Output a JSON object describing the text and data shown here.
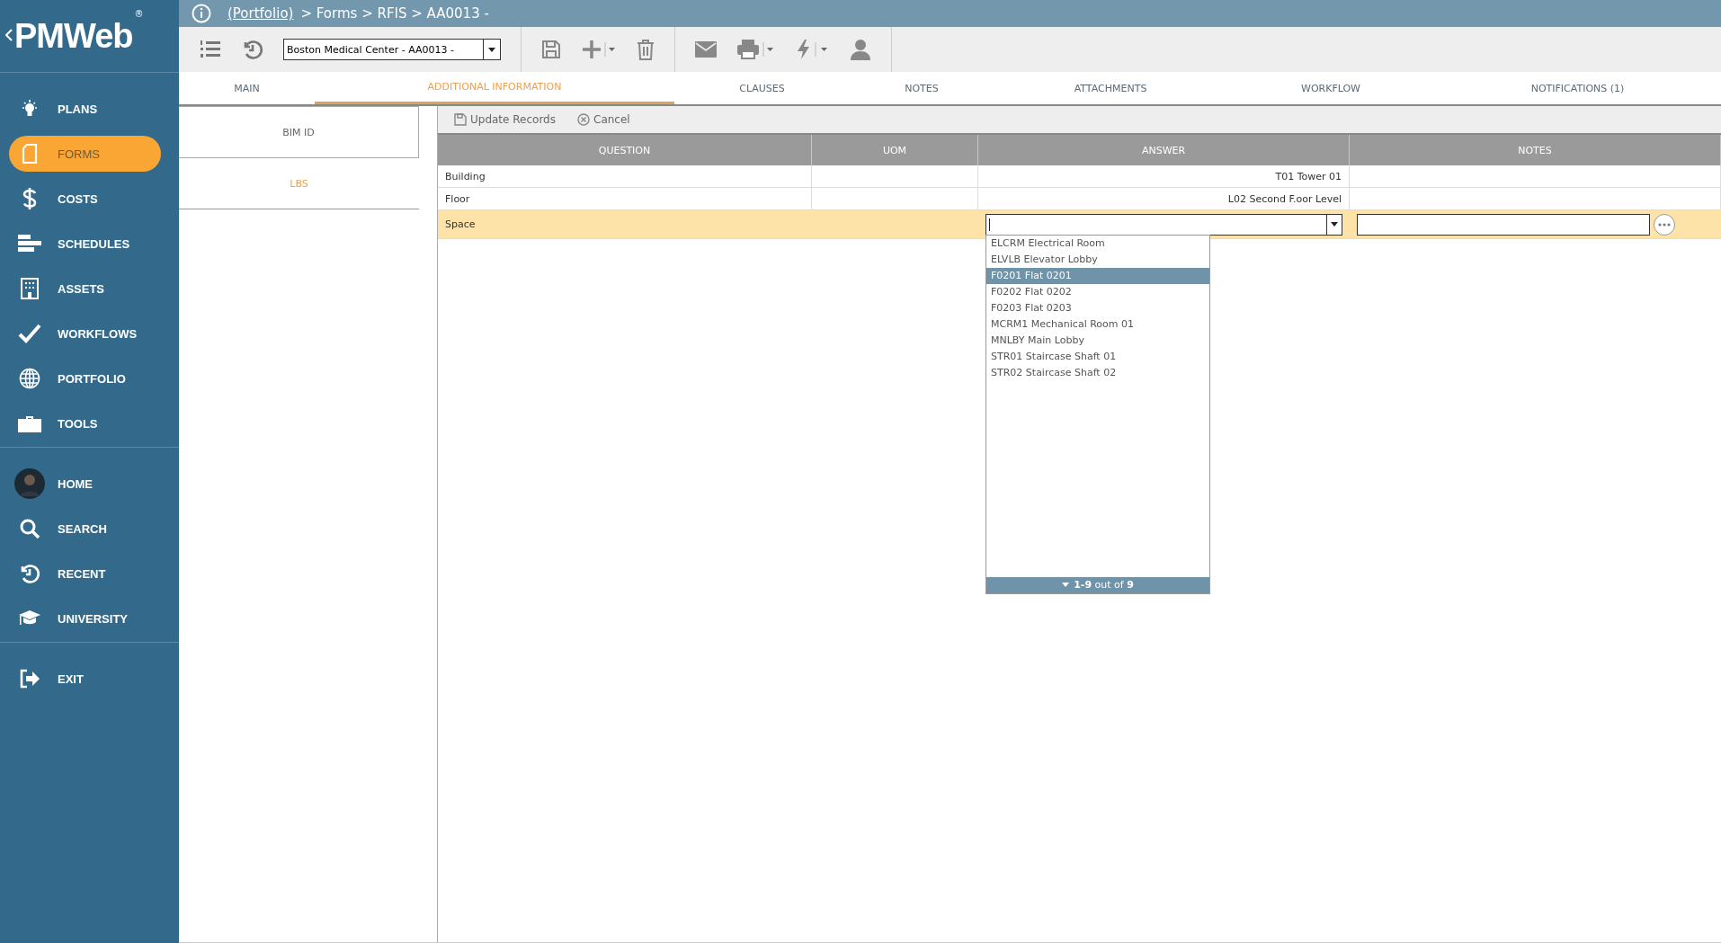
{
  "logo": {
    "text": "PMWeb",
    "mark": "®"
  },
  "sidebar": {
    "groups": [
      [
        {
          "label": "PLANS",
          "kind": "bulb",
          "selected": false
        },
        {
          "label": "FORMS",
          "kind": "doc",
          "selected": true
        },
        {
          "label": "COSTS",
          "kind": "dollar",
          "selected": false
        },
        {
          "label": "SCHEDULES",
          "kind": "bars",
          "selected": false
        },
        {
          "label": "ASSETS",
          "kind": "building",
          "selected": false
        },
        {
          "label": "WORKFLOWS",
          "kind": "check",
          "selected": false
        },
        {
          "label": "PORTFOLIO",
          "kind": "globe",
          "selected": false
        },
        {
          "label": "TOOLS",
          "kind": "case",
          "selected": false
        }
      ],
      [
        {
          "label": "HOME",
          "kind": "avatar",
          "selected": false
        },
        {
          "label": "SEARCH",
          "kind": "search",
          "selected": false
        },
        {
          "label": "RECENT",
          "kind": "history",
          "selected": false
        },
        {
          "label": "UNIVERSITY",
          "kind": "cap",
          "selected": false
        }
      ],
      [
        {
          "label": "EXIT",
          "kind": "exit",
          "selected": false
        }
      ]
    ]
  },
  "breadcrumb": {
    "link": "(Portfolio)",
    "text": "> Forms > RFIS > AA0013 -"
  },
  "toolbar": {
    "project_select": "Boston Medical Center - AA0013 -"
  },
  "tabs": [
    {
      "label": "MAIN",
      "selected": false
    },
    {
      "label": "ADDITIONAL INFORMATION",
      "selected": true
    },
    {
      "label": "CLAUSES",
      "selected": false
    },
    {
      "label": "NOTES",
      "selected": false
    },
    {
      "label": "ATTACHMENTS",
      "selected": false
    },
    {
      "label": "WORKFLOW",
      "selected": false
    },
    {
      "label": "NOTIFICATIONS (1)",
      "selected": false
    }
  ],
  "subnav": [
    {
      "label": "BIM ID",
      "selected": false
    },
    {
      "label": "LBS",
      "selected": true
    }
  ],
  "actions": [
    {
      "label": "Update Records",
      "kind": "save"
    },
    {
      "label": "Cancel",
      "kind": "cancel"
    }
  ],
  "table": {
    "columns": [
      "QUESTION",
      "UOM",
      "ANSWER",
      "NOTES"
    ],
    "rows": [
      {
        "kind": "text",
        "question": "Building",
        "uom": "",
        "answer": "T01 Tower 01",
        "notes": ""
      },
      {
        "kind": "text",
        "question": "Floor",
        "uom": "",
        "answer": "L02 Second F.oor Level",
        "notes": ""
      },
      {
        "kind": "editor",
        "question": "Space"
      }
    ]
  },
  "dropdown": {
    "options": [
      {
        "label": "ELCRM Electrical Room",
        "selected": false
      },
      {
        "label": "ELVLB Elevator Lobby",
        "selected": false
      },
      {
        "label": "F0201 Flat 0201",
        "selected": true
      },
      {
        "label": "F0202 Flat 0202",
        "selected": false
      },
      {
        "label": "F0203 Flat 0203",
        "selected": false
      },
      {
        "label": "MCRM1 Mechanical Room 01",
        "selected": false
      },
      {
        "label": "MNLBY Main Lobby",
        "selected": false
      },
      {
        "label": "STR01 Staircase Shaft 01",
        "selected": false
      },
      {
        "label": "STR02 Staircase Shaft 02",
        "selected": false
      }
    ],
    "footer": "**1-9** out of **9**"
  }
}
